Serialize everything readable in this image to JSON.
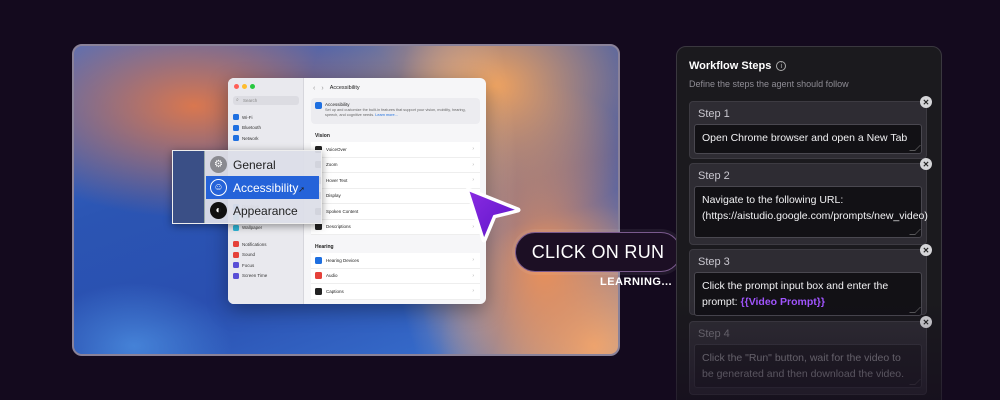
{
  "settings": {
    "search_placeholder": "Search",
    "title": "Accessibility",
    "hero_title": "Accessibility",
    "hero_desc": "Set up and customize the built-in features that support your vision, mobility, hearing, speech, and cognitive needs.",
    "hero_link": "Learn more...",
    "sidebar": [
      {
        "label": "Wi-Fi",
        "color": "#1e6fe0"
      },
      {
        "label": "Bluetooth",
        "color": "#1e6fe0"
      },
      {
        "label": "Network",
        "color": "#1e6fe0"
      },
      {
        "label": "Displays",
        "color": "#1e6fe0"
      },
      {
        "label": "Screen Saver",
        "color": "#2fb5d6"
      },
      {
        "label": "Wallpaper",
        "color": "#2fb5d6"
      },
      {
        "label": "Notifications",
        "color": "#e5413a"
      },
      {
        "label": "Sound",
        "color": "#e5413a"
      },
      {
        "label": "Focus",
        "color": "#5a4fd6"
      },
      {
        "label": "Screen Time",
        "color": "#5a4fd6"
      }
    ],
    "vision_header": "Vision",
    "vision_rows": [
      {
        "label": "VoiceOver",
        "color": "#222"
      },
      {
        "label": "Zoom",
        "color": "#222"
      },
      {
        "label": "Hover Text",
        "color": "#222"
      },
      {
        "label": "Display",
        "color": "#222"
      },
      {
        "label": "Spoken Content",
        "color": "#222"
      },
      {
        "label": "Descriptions",
        "color": "#222"
      }
    ],
    "hearing_header": "Hearing",
    "hearing_rows": [
      {
        "label": "Hearing Devices",
        "color": "#1e6fe0"
      },
      {
        "label": "Audio",
        "color": "#e5413a"
      },
      {
        "label": "Captions",
        "color": "#222"
      }
    ]
  },
  "zoom": {
    "items": [
      {
        "label": "General",
        "icon": "gear-icon",
        "selected": false
      },
      {
        "label": "Accessibility",
        "icon": "accessibility-icon",
        "selected": true
      },
      {
        "label": "Appearance",
        "icon": "appearance-icon",
        "selected": false
      }
    ]
  },
  "overlay": {
    "click_label": "CLICK ON RUN",
    "status": "LEARNING..."
  },
  "panel": {
    "title": "Workflow Steps",
    "info_icon": "info-icon",
    "subtitle": "Define the steps the agent should follow",
    "steps": [
      {
        "label": "Step 1",
        "text": "Open Chrome browser and open a New Tab",
        "var": ""
      },
      {
        "label": "Step 2",
        "text": "Navigate to the following URL: (https://aistudio.google.com/prompts/new_video)",
        "var": ""
      },
      {
        "label": "Step 3",
        "text": "Click the prompt input box and enter the prompt: ",
        "var": "{{Video Prompt}}"
      },
      {
        "label": "Step 4",
        "text": "Click the \"Run\" button, wait for the video to be generated and then download the video.",
        "var": ""
      }
    ]
  }
}
